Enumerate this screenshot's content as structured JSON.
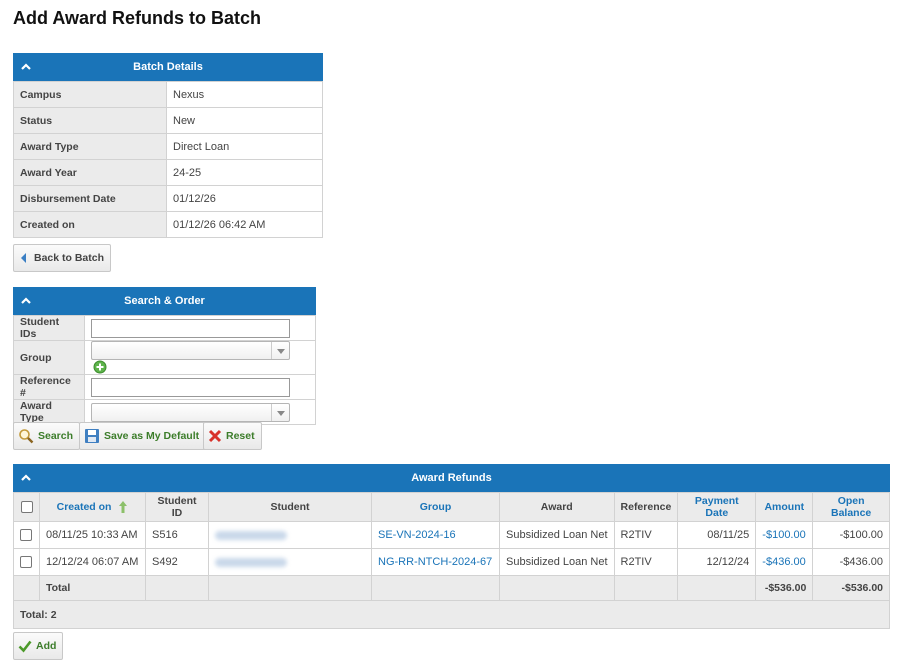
{
  "page_title": "Add Award Refunds to Batch",
  "batch_details": {
    "title": "Batch Details",
    "rows": [
      {
        "label": "Campus",
        "value": "Nexus"
      },
      {
        "label": "Status",
        "value": "New"
      },
      {
        "label": "Award Type",
        "value": "Direct Loan"
      },
      {
        "label": "Award Year",
        "value": "24-25"
      },
      {
        "label": "Disbursement Date",
        "value": "01/12/26"
      },
      {
        "label": "Created on",
        "value": "01/12/26 06:42 AM"
      }
    ]
  },
  "back_button": "Back to Batch",
  "search": {
    "title": "Search & Order",
    "student_ids_label": "Student IDs",
    "student_ids_value": "",
    "group_label": "Group",
    "group_value": "",
    "reference_label": "Reference #",
    "reference_value": "",
    "award_type_label": "Award Type",
    "award_type_value": "",
    "search_btn": "Search",
    "save_default_btn": "Save as My Default",
    "reset_btn": "Reset"
  },
  "refunds": {
    "title": "Award Refunds",
    "columns": [
      "Created on",
      "Student ID",
      "Student",
      "Group",
      "Award",
      "Reference",
      "Payment Date",
      "Amount",
      "Open Balance"
    ],
    "rows": [
      {
        "created_on": "08/11/25 10:33 AM",
        "student_id": "S516",
        "group": "SE-VN-2024-16",
        "award": "Subsidized Loan Net",
        "reference": "R2TIV",
        "payment_date": "08/11/25",
        "amount": "-$100.00",
        "open_balance": "-$100.00"
      },
      {
        "created_on": "12/12/24 06:07 AM",
        "student_id": "S492",
        "group": "NG-RR-NTCH-2024-67",
        "award": "Subsidized Loan Net",
        "reference": "R2TIV",
        "payment_date": "12/12/24",
        "amount": "-$436.00",
        "open_balance": "-$436.00"
      }
    ],
    "total_label": "Total",
    "total_amount": "-$536.00",
    "total_open_balance": "-$536.00",
    "count_label": "Total: 2"
  },
  "add_button": "Add",
  "colors": {
    "header_blue": "#1a74b8",
    "link_blue": "#1a74b8",
    "green_text": "#3c7d2a"
  }
}
